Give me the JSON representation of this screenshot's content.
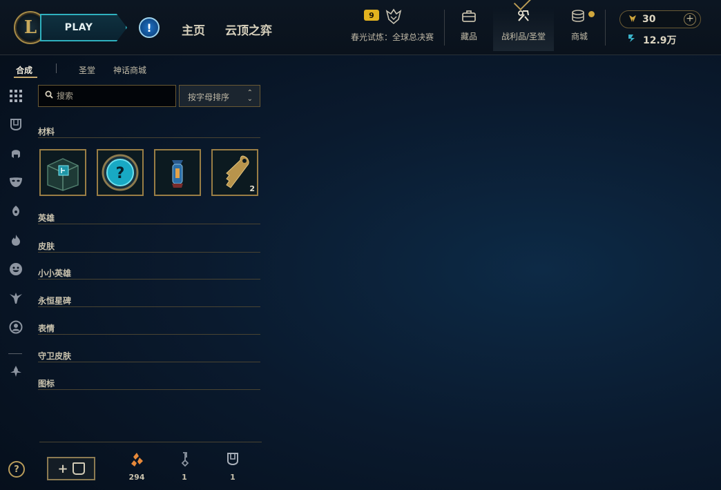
{
  "header": {
    "logo_letter": "L",
    "play_label": "PLAY",
    "alert_symbol": "!",
    "nav": [
      "主页",
      "云顶之弈"
    ],
    "event": {
      "badge": "9",
      "label": "春光试炼：全球总决赛"
    },
    "tiles": [
      {
        "icon": "briefcase-icon",
        "label": "藏品"
      },
      {
        "icon": "loot-icon",
        "label": "战利品/圣堂"
      },
      {
        "icon": "coins-icon",
        "label": "商城"
      }
    ],
    "rp": "30",
    "be": "12.9万"
  },
  "subtabs": [
    "合成",
    "圣堂",
    "神话商城"
  ],
  "search": {
    "placeholder": "搜索"
  },
  "sort": {
    "label": "按字母排序"
  },
  "categories": {
    "materials": "材料",
    "champions": "英雄",
    "skins": "皮肤",
    "little_legends": "小小英雄",
    "eternals": "永恒星碑",
    "emotes": "表情",
    "ward_skins": "守卫皮肤",
    "icons": "图标"
  },
  "materials": [
    {
      "name": "hextech-chest",
      "qty": ""
    },
    {
      "name": "mystery-orb",
      "qty": ""
    },
    {
      "name": "lantern",
      "qty": ""
    },
    {
      "name": "key",
      "qty": "2"
    }
  ],
  "bottom": {
    "add_label": "+",
    "essence": "294",
    "keys": "1",
    "chests": "1"
  },
  "colors": {
    "gold": "#c8aa6e",
    "teal": "#2fb1bf",
    "essence_orange": "#e8893a",
    "background": "#0a1a2e"
  },
  "help_symbol": "?"
}
